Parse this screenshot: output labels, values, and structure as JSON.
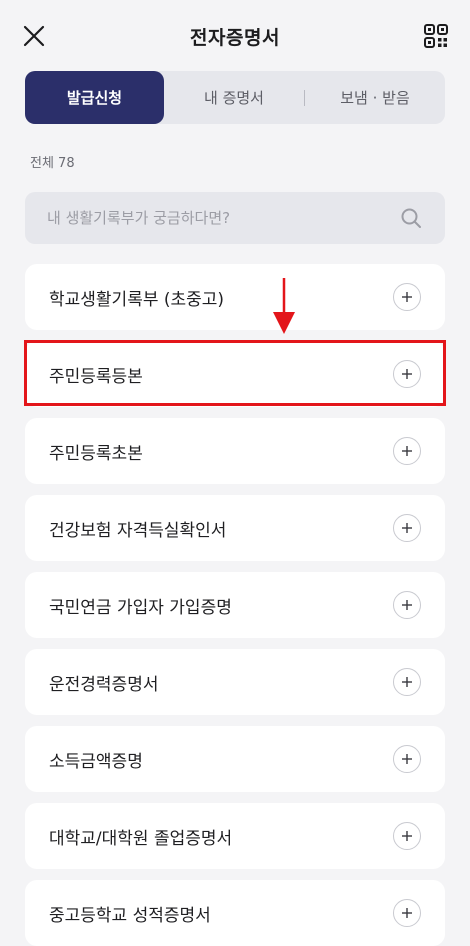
{
  "header": {
    "title": "전자증명서"
  },
  "tabs": [
    {
      "label": "발급신청",
      "active": true
    },
    {
      "label": "내 증명서",
      "active": false
    },
    {
      "label": "보냄 · 받음",
      "active": false
    }
  ],
  "count_text": "전체 78",
  "search": {
    "placeholder": "내 생활기록부가 궁금하다면?",
    "value": ""
  },
  "items": [
    {
      "label": "학교생활기록부 (초중고)"
    },
    {
      "label": "주민등록등본"
    },
    {
      "label": "주민등록초본"
    },
    {
      "label": "건강보험 자격득실확인서"
    },
    {
      "label": "국민연금 가입자 가입증명"
    },
    {
      "label": "운전경력증명서"
    },
    {
      "label": "소득금액증명"
    },
    {
      "label": "대학교/대학원 졸업증명서"
    },
    {
      "label": "중고등학교 성적증명서"
    }
  ],
  "colors": {
    "accent": "#2b2f6a",
    "annotation": "#e3151a",
    "background": "#f4f4f6"
  }
}
